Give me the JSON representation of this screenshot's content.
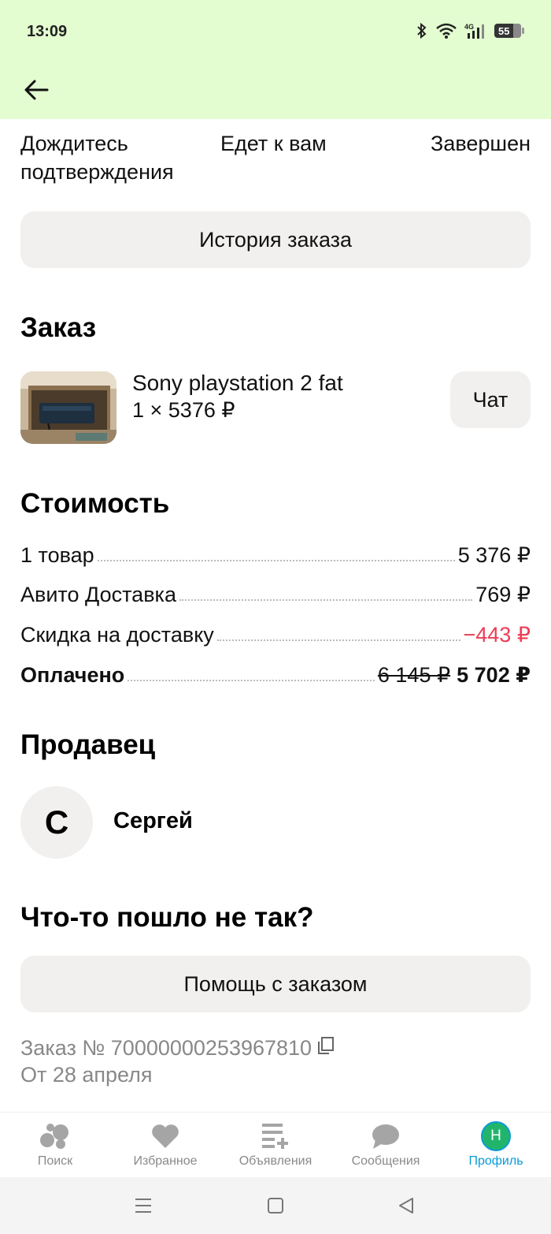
{
  "status_bar": {
    "time": "13:09",
    "battery": "55",
    "network": "4G",
    "icons": [
      "bluetooth-icon",
      "wifi-icon",
      "signal-icon",
      "battery-icon"
    ]
  },
  "header": {
    "back_icon": "arrow-left-icon",
    "background": "#e3fcd0"
  },
  "steps": {
    "step1": "Дождитесь подтверждения",
    "step2": "Едет к вам",
    "step3": "Завершен"
  },
  "history_button": "История заказа",
  "order": {
    "title": "Заказ",
    "item_name": "Sony playstation 2 fat",
    "item_qty": "1 × 5376 ₽",
    "chat_button": "Чат"
  },
  "cost": {
    "title": "Стоимость",
    "rows": [
      {
        "label": "1 товар",
        "value": "5 376 ₽"
      },
      {
        "label": "Авито Доставка",
        "value": "769 ₽"
      },
      {
        "label": "Скидка на доставку",
        "value": "−443 ₽"
      }
    ],
    "paid_label": "Оплачено",
    "paid_old": "6 145 ₽",
    "paid_value": "5 702 ₽",
    "discount_color": "#ed3d56"
  },
  "seller": {
    "title": "Продавец",
    "initial": "С",
    "name": "Сергей"
  },
  "trouble": {
    "title": "Что-то пошло не так?",
    "help_button": "Помощь с заказом"
  },
  "order_info": {
    "number": "Заказ № 70000000253967810",
    "date": "От 28 апреля"
  },
  "tabbar": {
    "tabs": [
      {
        "label": "Поиск",
        "icon": "search-dots-icon"
      },
      {
        "label": "Избранное",
        "icon": "heart-icon"
      },
      {
        "label": "Объявления",
        "icon": "add-listing-icon"
      },
      {
        "label": "Сообщения",
        "icon": "chat-bubble-icon"
      },
      {
        "label": "Профиль",
        "icon": "avatar"
      }
    ],
    "profile_initial": "Н",
    "active_color": "#0a9bd8"
  }
}
